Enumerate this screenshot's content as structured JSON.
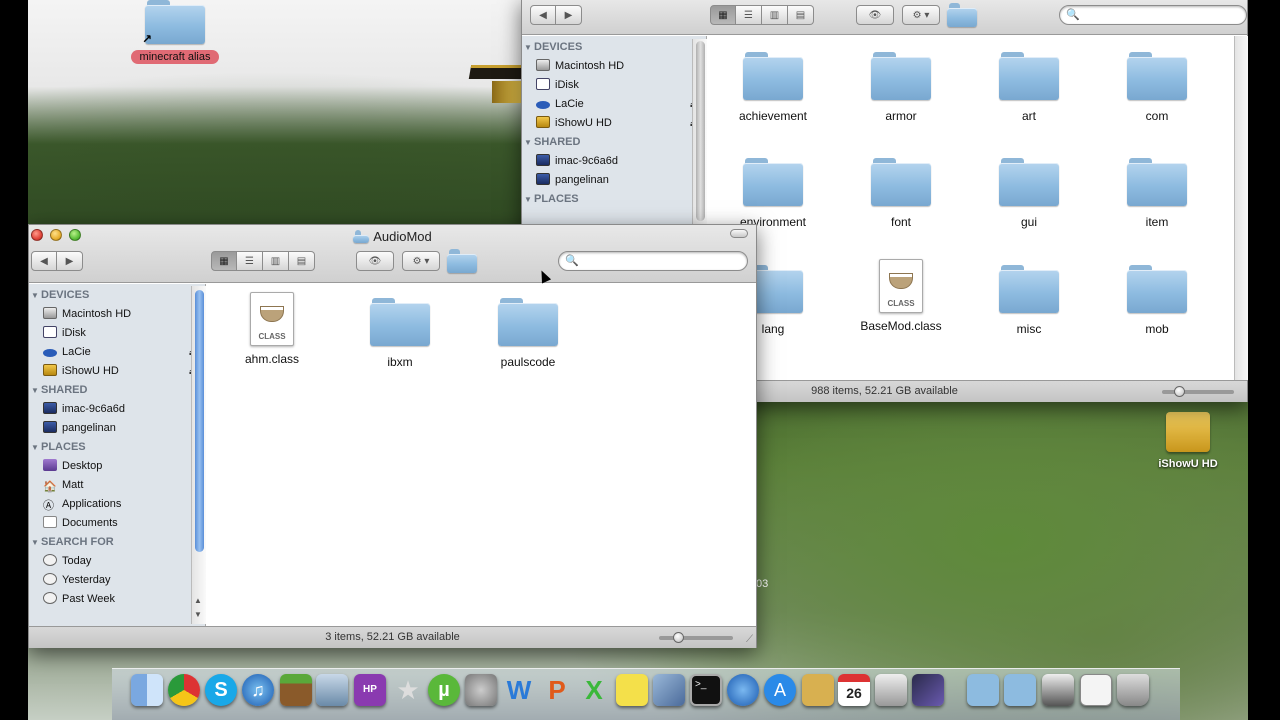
{
  "desktop": {
    "alias_label": "minecraft alias",
    "drive_label": "iShowU HD",
    "partial_text": "03"
  },
  "back_window": {
    "status": "988 items, 52.21 GB available",
    "sidebar": {
      "devices_header": "DEVICES",
      "devices": [
        "Macintosh HD",
        "iDisk",
        "LaCie",
        "iShowU HD"
      ],
      "shared_header": "SHARED",
      "shared": [
        "imac-9c6a6d",
        "pangelinan"
      ],
      "places_header": "PLACES"
    },
    "items": [
      {
        "label": "achievement",
        "kind": "folder"
      },
      {
        "label": "armor",
        "kind": "folder"
      },
      {
        "label": "art",
        "kind": "folder"
      },
      {
        "label": "com",
        "kind": "folder"
      },
      {
        "label": "environment",
        "kind": "folder"
      },
      {
        "label": "font",
        "kind": "folder"
      },
      {
        "label": "gui",
        "kind": "folder"
      },
      {
        "label": "item",
        "kind": "folder"
      },
      {
        "label": "lang",
        "kind": "folder"
      },
      {
        "label": "BaseMod.class",
        "kind": "class"
      },
      {
        "label": "misc",
        "kind": "folder"
      },
      {
        "label": "mob",
        "kind": "folder"
      }
    ]
  },
  "front_window": {
    "title": "AudioMod",
    "status": "3 items, 52.21 GB available",
    "search_placeholder": "",
    "class_badge": "CLASS",
    "sidebar": {
      "devices_header": "DEVICES",
      "devices": [
        "Macintosh HD",
        "iDisk",
        "LaCie",
        "iShowU HD"
      ],
      "shared_header": "SHARED",
      "shared": [
        "imac-9c6a6d",
        "pangelinan"
      ],
      "places_header": "PLACES",
      "places": [
        "Desktop",
        "Matt",
        "Applications",
        "Documents"
      ],
      "search_header": "SEARCH FOR",
      "search": [
        "Today",
        "Yesterday",
        "Past Week"
      ]
    },
    "items": [
      {
        "label": "ahm.class",
        "kind": "class"
      },
      {
        "label": "ibxm",
        "kind": "folder"
      },
      {
        "label": "paulscode",
        "kind": "folder"
      }
    ]
  },
  "dock": {
    "calendar_day": "26",
    "icons": [
      "finder-icon",
      "chrome-icon",
      "skype-icon",
      "itunes-icon",
      "minecraft-icon",
      "imovie-icon",
      "hp-icon",
      "imovie-star-icon",
      "utorrent-icon",
      "settings-icon",
      "word-icon",
      "powerpoint-icon",
      "excel-icon",
      "stickies-icon",
      "preview-icon",
      "terminal-icon",
      "network-icon",
      "app-store-icon",
      "notebook-icon",
      "ical-icon",
      "screenshot-icon",
      "game-icon",
      "applications-stack-icon",
      "downloads-stack-icon",
      "folder-stack-icon",
      "documents-stack-icon",
      "trash-icon"
    ]
  },
  "colors": {
    "sidebar_bg": "#dee4ea",
    "folder_blue": "#8dbbe0",
    "alias_pill": "#e06a74",
    "scroll_blue": "#5a8fd8"
  }
}
